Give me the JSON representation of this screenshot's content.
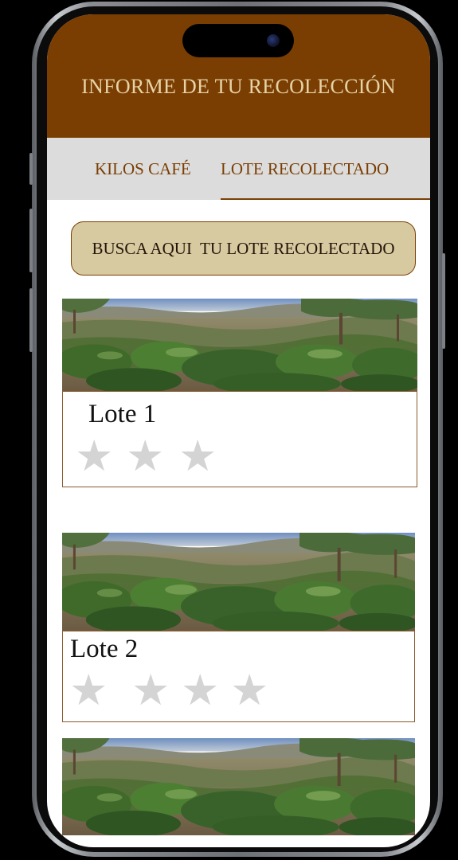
{
  "header": {
    "title": "INFORME DE TU RECOLECCIÓN",
    "background_color": "#7b3e02",
    "title_color": "#e6d3a8"
  },
  "tabs": [
    {
      "label": "KILOS CAFÉ",
      "active": false
    },
    {
      "label": "LOTE RECOLECTADO",
      "active": true
    }
  ],
  "search": {
    "label": "BUSCA AQUI  TU LOTE RECOLECTADO"
  },
  "lots": [
    {
      "name": "Lote 1",
      "rating": 3,
      "image": "coffee-farm-photo"
    },
    {
      "name": "Lote 2",
      "rating": 4,
      "image": "coffee-farm-photo"
    },
    {
      "name": "",
      "rating": 0,
      "image": "coffee-farm-photo"
    }
  ],
  "icons": {
    "star": "star-icon",
    "star_color": "#d4d4d4"
  }
}
